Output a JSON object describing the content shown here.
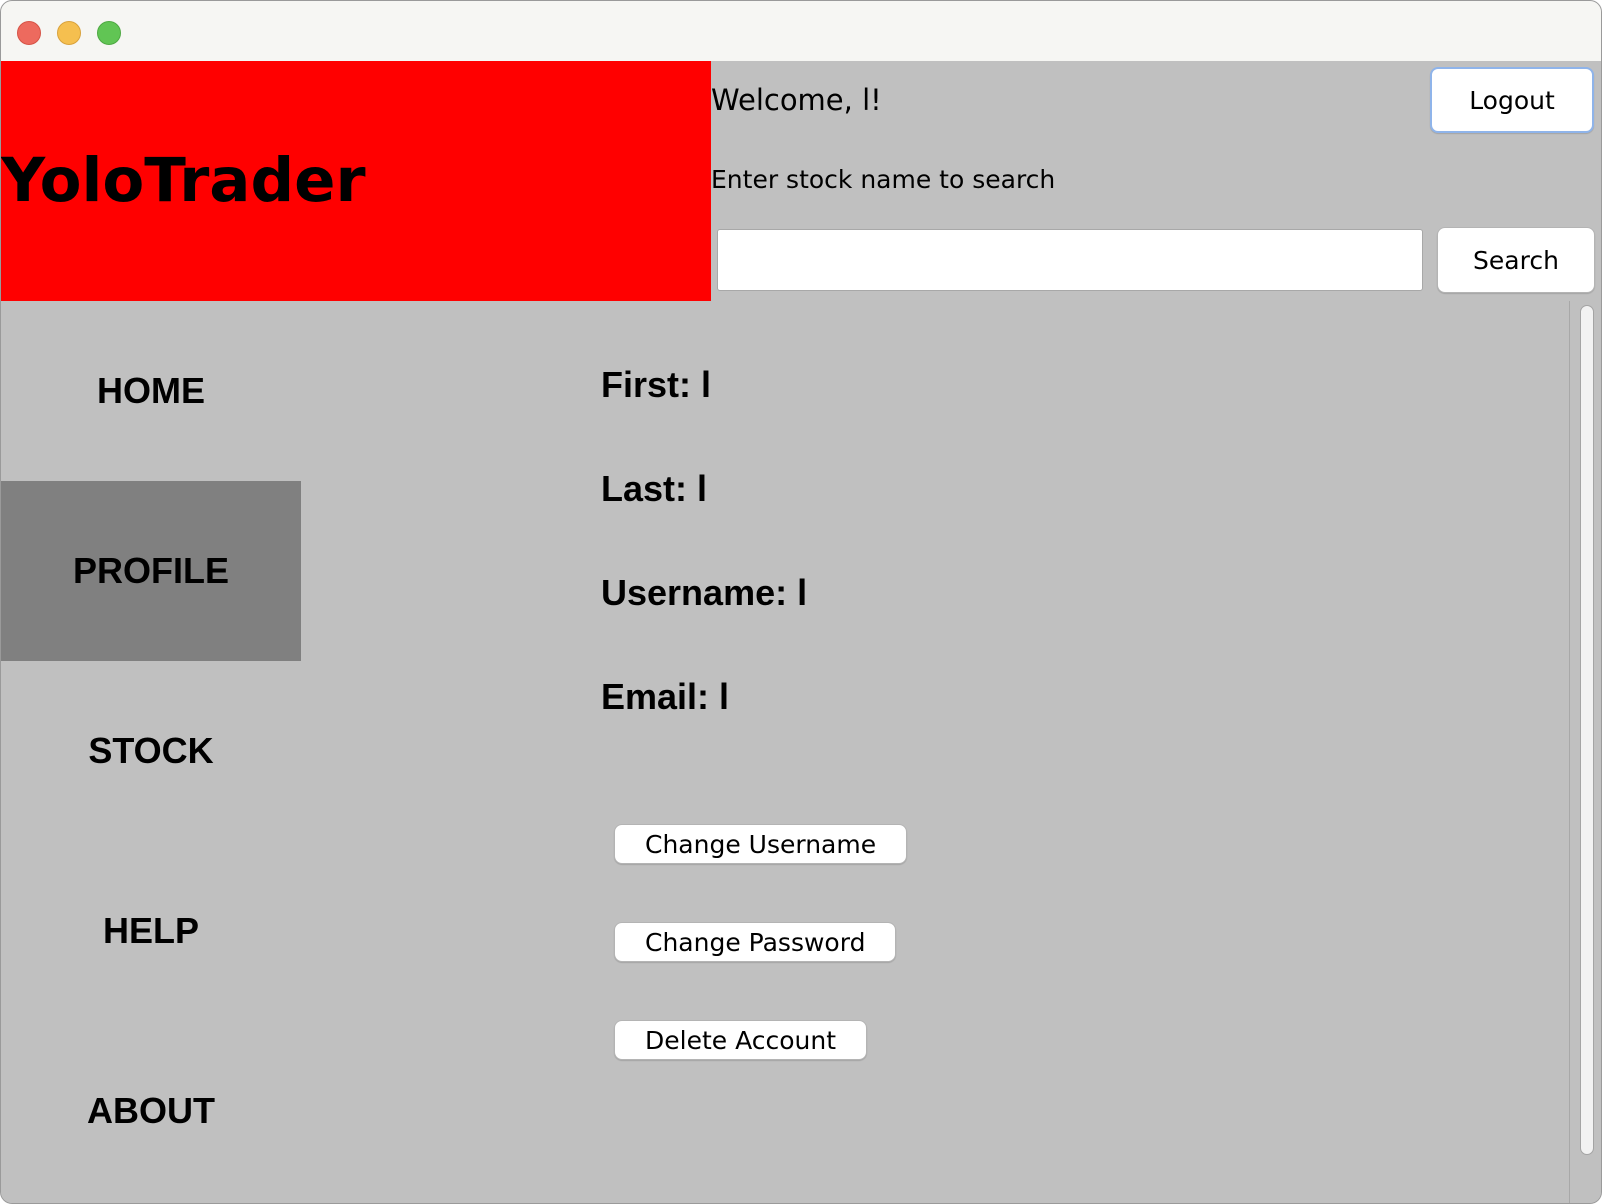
{
  "app": {
    "brand_title": "YoloTrader"
  },
  "header": {
    "welcome_text": "Welcome, l!",
    "logout_label": "Logout",
    "search_label": "Enter stock name to search",
    "search_value": "",
    "search_button_label": "Search"
  },
  "sidebar": {
    "items": [
      {
        "label": "HOME",
        "active": false
      },
      {
        "label": "PROFILE",
        "active": true
      },
      {
        "label": "STOCK",
        "active": false
      },
      {
        "label": "HELP",
        "active": false
      },
      {
        "label": "ABOUT",
        "active": false
      }
    ]
  },
  "profile": {
    "first_text": "First: l",
    "last_text": "Last: l",
    "username_text": "Username: l",
    "email_text": "Email: l",
    "change_username_label": "Change Username",
    "change_password_label": "Change Password",
    "delete_account_label": "Delete Account"
  },
  "colors": {
    "brand_background": "#ff0000",
    "panel_background": "#c0c0c0",
    "active_nav_background": "#808080"
  }
}
